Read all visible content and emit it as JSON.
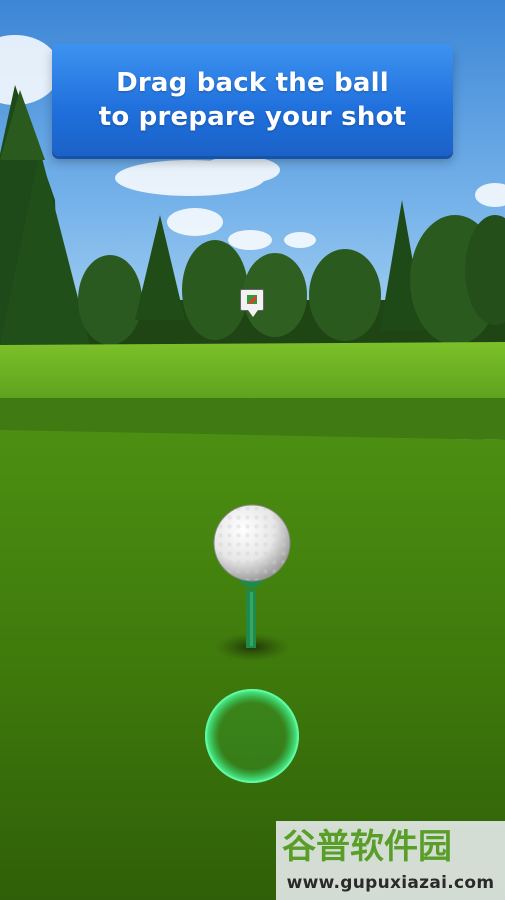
{
  "tutorial": {
    "line1": "Drag back the ball",
    "line2": "to prepare your shot"
  },
  "icons": {
    "pin": "flag-pin-icon",
    "ball": "golf-ball-icon",
    "aim": "aim-ring-icon"
  },
  "colors": {
    "banner": "#2a7ee6",
    "aim_ring": "#37e07a",
    "tee": "#1f8a4c",
    "flag": "#e03b2e"
  },
  "watermark": {
    "logo_text": "谷普软件园",
    "url": "www.gupuxiazai.com"
  }
}
